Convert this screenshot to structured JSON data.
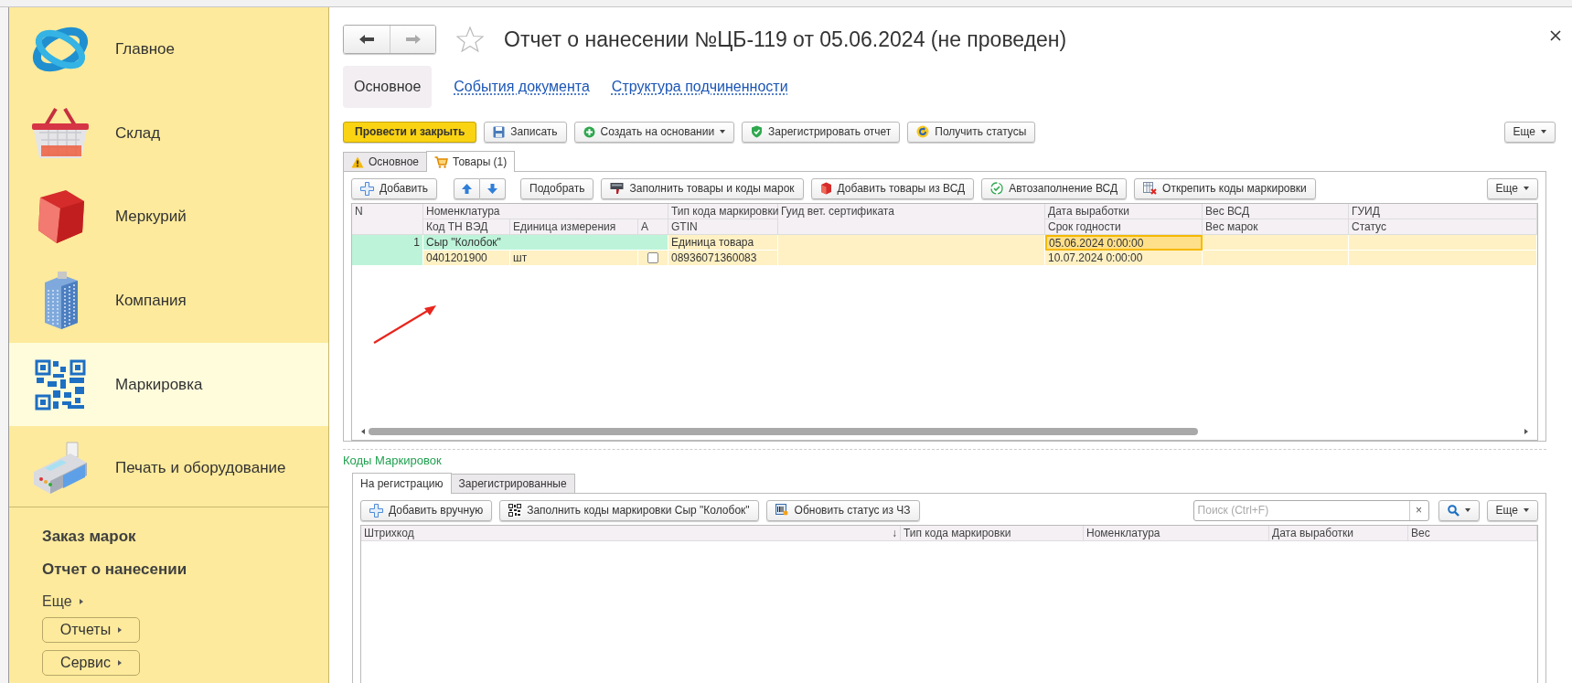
{
  "sidebar": {
    "sections": [
      {
        "label": "Главное",
        "kind": "orbit",
        "selected": false
      },
      {
        "label": "Склад",
        "kind": "basket",
        "selected": false
      },
      {
        "label": "Меркурий",
        "kind": "cube",
        "selected": false
      },
      {
        "label": "Компания",
        "kind": "building",
        "selected": false
      },
      {
        "label": "Маркировка",
        "kind": "qr",
        "selected": true
      },
      {
        "label": "Печать и оборудование",
        "kind": "terminal",
        "selected": false
      }
    ],
    "actions": [
      {
        "label": "Заказ марок",
        "kind": "link"
      },
      {
        "label": "Отчет о нанесении",
        "kind": "link"
      },
      {
        "label": "Еще",
        "kind": "more"
      },
      {
        "label": "Отчеты",
        "kind": "button"
      },
      {
        "label": "Сервис",
        "kind": "button"
      }
    ]
  },
  "document": {
    "title": "Отчет о нанесении №ЦБ-119 от 05.06.2024 (не проведен)",
    "starred": false,
    "nav_tabs": [
      {
        "label": "Основное",
        "selected": true
      },
      {
        "label": "События документа",
        "selected": false
      },
      {
        "label": "Структура подчиненности",
        "selected": false
      }
    ],
    "commands": [
      {
        "label": "Провести и закрыть",
        "kind": "primary"
      },
      {
        "label": "Записать",
        "kind": "save"
      },
      {
        "label": "Создать на основании",
        "kind": "create"
      },
      {
        "label": "Зарегистрировать отчет",
        "kind": "shield"
      },
      {
        "label": "Получить статусы",
        "kind": "refresh"
      }
    ],
    "more": "Еще"
  },
  "form_tabs": [
    {
      "label": "Основное",
      "kind": "warning",
      "selected": false
    },
    {
      "label": "Товары (1)",
      "kind": "cart",
      "selected": true
    }
  ],
  "goods": {
    "toolbar": [
      {
        "label": "Добавить",
        "kind": "plus"
      },
      {
        "kind": "up"
      },
      {
        "kind": "down"
      },
      {
        "label": "Подобрать",
        "kind": "text"
      },
      {
        "label": "Заполнить товары и коды марок",
        "kind": "printer"
      },
      {
        "label": "Добавить товары из ВСД",
        "kind": "cube"
      },
      {
        "label": "Автозаполнение ВСД",
        "kind": "check"
      },
      {
        "label": "Открепить коды маркировки",
        "kind": "unlink"
      }
    ],
    "more": "Еще",
    "columns": {
      "n": "N",
      "nomenclature": "Номенклатура",
      "tn_ved_code": "Код ТН ВЭД",
      "unit": "Единица измерения",
      "a": "А",
      "marking_code_type": "Тип кода маркировки",
      "gtin": "GTIN",
      "vet_cert_guid": "Гуид вет. сертификата",
      "production_date": "Дата выработки",
      "expiry_date": "Срок годности",
      "vsd_weight": "Вес ВСД",
      "marks_weight": "Вес марок",
      "guid": "ГУИД",
      "status": "Статус"
    },
    "rows": [
      {
        "n": "1",
        "nomenclature": "Сыр \"Колобок\"",
        "tn_ved_code": "0401201900",
        "unit": "шт",
        "a": false,
        "marking_code_type": "Единица товара",
        "gtin": "08936071360083",
        "production_date": "05.06.2024 0:00:00",
        "expiry_date": "10.07.2024 0:00:00",
        "selected": true
      }
    ]
  },
  "codes": {
    "title": "Коды Маркировок",
    "tabs": [
      {
        "label": "На регистрацию",
        "selected": true
      },
      {
        "label": "Зарегистрированные",
        "selected": false
      }
    ],
    "toolbar": [
      {
        "label": "Добавить вручную",
        "kind": "plus"
      },
      {
        "label": "Заполнить коды маркировки Сыр \"Колобок\"",
        "kind": "qr"
      },
      {
        "label": "Обновить статус из ЧЗ",
        "kind": "scan"
      }
    ],
    "search": {
      "placeholder": "Поиск (Ctrl+F)",
      "clear_mark": "×"
    },
    "more": "Еще",
    "columns": [
      {
        "label": "Штрихкод",
        "sort_mark": "↓"
      },
      {
        "label": "Тип кода маркировки"
      },
      {
        "label": "Номенклатура"
      },
      {
        "label": "Дата выработки"
      },
      {
        "label": "Вес"
      }
    ]
  }
}
